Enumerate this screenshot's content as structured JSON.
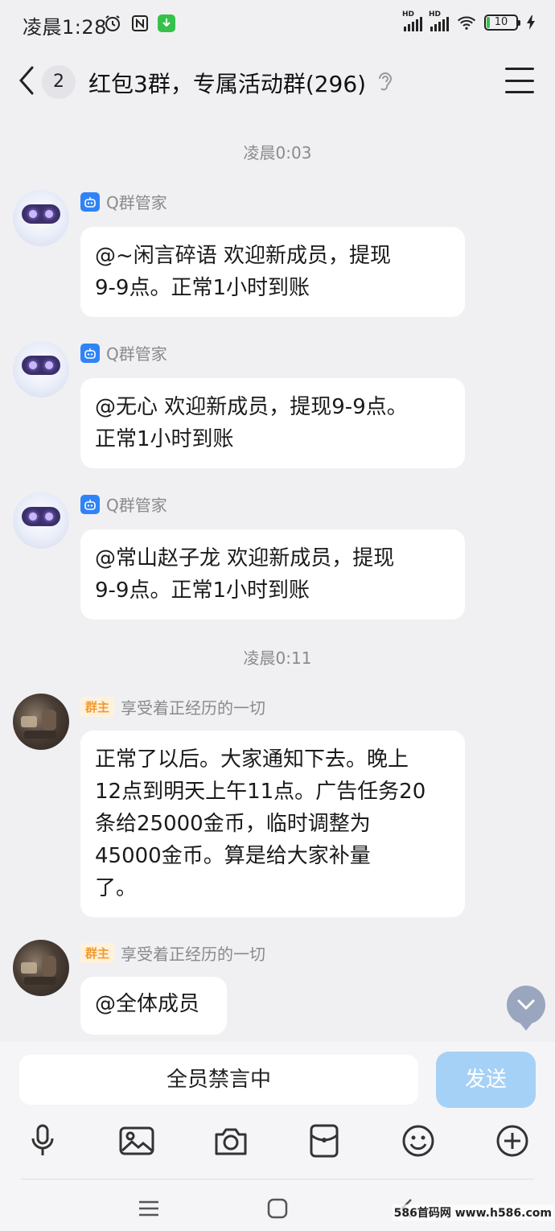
{
  "status_bar": {
    "time": "凌晨1:28",
    "battery": "10",
    "signal_label": "HD"
  },
  "header": {
    "unread_count": "2",
    "title": "红包3群，专属活动群(296)"
  },
  "timestamps": [
    "凌晨0:03",
    "凌晨0:11"
  ],
  "messages": [
    {
      "sender": "Q群管家",
      "text_lines": [
        "@~闲言碎语 欢迎新成员，提现",
        "9-9点。正常1小时到账"
      ]
    },
    {
      "sender": "Q群管家",
      "text_lines": [
        "@无心 欢迎新成员，提现9-9点。",
        "正常1小时到账"
      ]
    },
    {
      "sender": "Q群管家",
      "text_lines": [
        "@常山赵子龙 欢迎新成员，提现",
        "9-9点。正常1小时到账"
      ]
    },
    {
      "sender": "享受着正经历的一切",
      "badge": "群主",
      "text_lines": [
        "正常了以后。大家通知下去。晚上",
        "12点到明天上午11点。广告任务20",
        "条给25000金币，临时调整为",
        "45000金币。算是给大家补量",
        "了。"
      ]
    },
    {
      "sender": "享受着正经历的一切",
      "badge": "群主",
      "text_lines": [
        "@全体成员"
      ]
    }
  ],
  "input": {
    "muted_text": "全员禁言中",
    "send_label": "发送"
  },
  "toolbar_icons": [
    "microphone-icon",
    "image-icon",
    "camera-icon",
    "red-packet-icon",
    "emoji-icon",
    "plus-icon"
  ],
  "watermark": "586首码网 www.h586.com",
  "colors": {
    "bot_badge": "#2f83f6",
    "owner_badge_text": "#f29a2e",
    "owner_badge_bg": "#fff1dc",
    "send_button": "#a6d1f7",
    "background": "#f0f0f3"
  }
}
